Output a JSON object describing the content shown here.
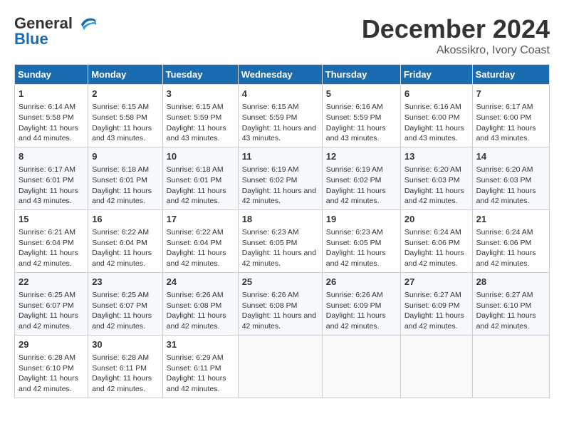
{
  "header": {
    "logo_general": "General",
    "logo_blue": "Blue",
    "month_title": "December 2024",
    "location": "Akossikro, Ivory Coast"
  },
  "days_of_week": [
    "Sunday",
    "Monday",
    "Tuesday",
    "Wednesday",
    "Thursday",
    "Friday",
    "Saturday"
  ],
  "weeks": [
    [
      {
        "day": "1",
        "sunrise": "6:14 AM",
        "sunset": "5:58 PM",
        "daylight": "11 hours and 44 minutes."
      },
      {
        "day": "2",
        "sunrise": "6:15 AM",
        "sunset": "5:58 PM",
        "daylight": "11 hours and 43 minutes."
      },
      {
        "day": "3",
        "sunrise": "6:15 AM",
        "sunset": "5:59 PM",
        "daylight": "11 hours and 43 minutes."
      },
      {
        "day": "4",
        "sunrise": "6:15 AM",
        "sunset": "5:59 PM",
        "daylight": "11 hours and 43 minutes."
      },
      {
        "day": "5",
        "sunrise": "6:16 AM",
        "sunset": "5:59 PM",
        "daylight": "11 hours and 43 minutes."
      },
      {
        "day": "6",
        "sunrise": "6:16 AM",
        "sunset": "6:00 PM",
        "daylight": "11 hours and 43 minutes."
      },
      {
        "day": "7",
        "sunrise": "6:17 AM",
        "sunset": "6:00 PM",
        "daylight": "11 hours and 43 minutes."
      }
    ],
    [
      {
        "day": "8",
        "sunrise": "6:17 AM",
        "sunset": "6:01 PM",
        "daylight": "11 hours and 43 minutes."
      },
      {
        "day": "9",
        "sunrise": "6:18 AM",
        "sunset": "6:01 PM",
        "daylight": "11 hours and 42 minutes."
      },
      {
        "day": "10",
        "sunrise": "6:18 AM",
        "sunset": "6:01 PM",
        "daylight": "11 hours and 42 minutes."
      },
      {
        "day": "11",
        "sunrise": "6:19 AM",
        "sunset": "6:02 PM",
        "daylight": "11 hours and 42 minutes."
      },
      {
        "day": "12",
        "sunrise": "6:19 AM",
        "sunset": "6:02 PM",
        "daylight": "11 hours and 42 minutes."
      },
      {
        "day": "13",
        "sunrise": "6:20 AM",
        "sunset": "6:03 PM",
        "daylight": "11 hours and 42 minutes."
      },
      {
        "day": "14",
        "sunrise": "6:20 AM",
        "sunset": "6:03 PM",
        "daylight": "11 hours and 42 minutes."
      }
    ],
    [
      {
        "day": "15",
        "sunrise": "6:21 AM",
        "sunset": "6:04 PM",
        "daylight": "11 hours and 42 minutes."
      },
      {
        "day": "16",
        "sunrise": "6:22 AM",
        "sunset": "6:04 PM",
        "daylight": "11 hours and 42 minutes."
      },
      {
        "day": "17",
        "sunrise": "6:22 AM",
        "sunset": "6:04 PM",
        "daylight": "11 hours and 42 minutes."
      },
      {
        "day": "18",
        "sunrise": "6:23 AM",
        "sunset": "6:05 PM",
        "daylight": "11 hours and 42 minutes."
      },
      {
        "day": "19",
        "sunrise": "6:23 AM",
        "sunset": "6:05 PM",
        "daylight": "11 hours and 42 minutes."
      },
      {
        "day": "20",
        "sunrise": "6:24 AM",
        "sunset": "6:06 PM",
        "daylight": "11 hours and 42 minutes."
      },
      {
        "day": "21",
        "sunrise": "6:24 AM",
        "sunset": "6:06 PM",
        "daylight": "11 hours and 42 minutes."
      }
    ],
    [
      {
        "day": "22",
        "sunrise": "6:25 AM",
        "sunset": "6:07 PM",
        "daylight": "11 hours and 42 minutes."
      },
      {
        "day": "23",
        "sunrise": "6:25 AM",
        "sunset": "6:07 PM",
        "daylight": "11 hours and 42 minutes."
      },
      {
        "day": "24",
        "sunrise": "6:26 AM",
        "sunset": "6:08 PM",
        "daylight": "11 hours and 42 minutes."
      },
      {
        "day": "25",
        "sunrise": "6:26 AM",
        "sunset": "6:08 PM",
        "daylight": "11 hours and 42 minutes."
      },
      {
        "day": "26",
        "sunrise": "6:26 AM",
        "sunset": "6:09 PM",
        "daylight": "11 hours and 42 minutes."
      },
      {
        "day": "27",
        "sunrise": "6:27 AM",
        "sunset": "6:09 PM",
        "daylight": "11 hours and 42 minutes."
      },
      {
        "day": "28",
        "sunrise": "6:27 AM",
        "sunset": "6:10 PM",
        "daylight": "11 hours and 42 minutes."
      }
    ],
    [
      {
        "day": "29",
        "sunrise": "6:28 AM",
        "sunset": "6:10 PM",
        "daylight": "11 hours and 42 minutes."
      },
      {
        "day": "30",
        "sunrise": "6:28 AM",
        "sunset": "6:11 PM",
        "daylight": "11 hours and 42 minutes."
      },
      {
        "day": "31",
        "sunrise": "6:29 AM",
        "sunset": "6:11 PM",
        "daylight": "11 hours and 42 minutes."
      },
      null,
      null,
      null,
      null
    ]
  ]
}
